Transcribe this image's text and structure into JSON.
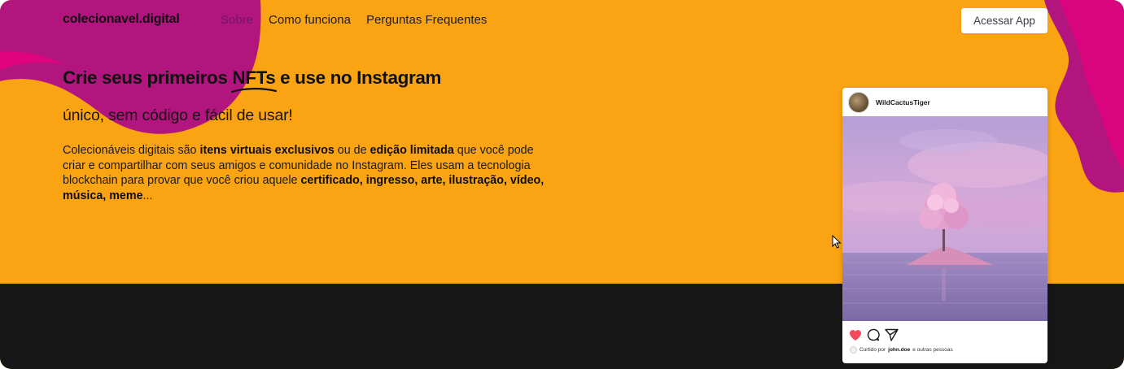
{
  "nav": {
    "brand": "colecionavel.digital",
    "links": [
      {
        "label": "Sobre"
      },
      {
        "label": "Como funciona"
      },
      {
        "label": "Perguntas Frequentes"
      }
    ],
    "cta_label": "Acessar App"
  },
  "hero": {
    "headline_before": "Crie seus primeiros ",
    "headline_highlight": "NFTs",
    "headline_after": " e use no Instagram",
    "subtitle": "único, sem código e fácil de usar!",
    "paragraph": {
      "p1": "Colecionáveis digitais são ",
      "b1": "itens virtuais exclusivos",
      "p2": " ou de ",
      "b2": "edição limitada",
      "p3": " que você pode criar e compartilhar com seus amigos e comunidade no Instagram. Eles usam a tecnologia blockchain para provar que você criou aquele ",
      "b3": "certificado, ingresso, arte, ilustração, vídeo, música, meme",
      "p4": "..."
    }
  },
  "post": {
    "username": "WildCactusTiger",
    "likes_prefix": "Curtido por ",
    "likes_user": "john.doe",
    "likes_suffix": " e outras pessoas",
    "icons": [
      "heart-icon",
      "comment-icon",
      "share-icon"
    ]
  },
  "colors": {
    "hero_bg": "#fba413",
    "blob_magenta": "#b5147e",
    "blob_pink": "#e5007d",
    "dark_band": "#171717",
    "like_red": "#f2495c"
  }
}
